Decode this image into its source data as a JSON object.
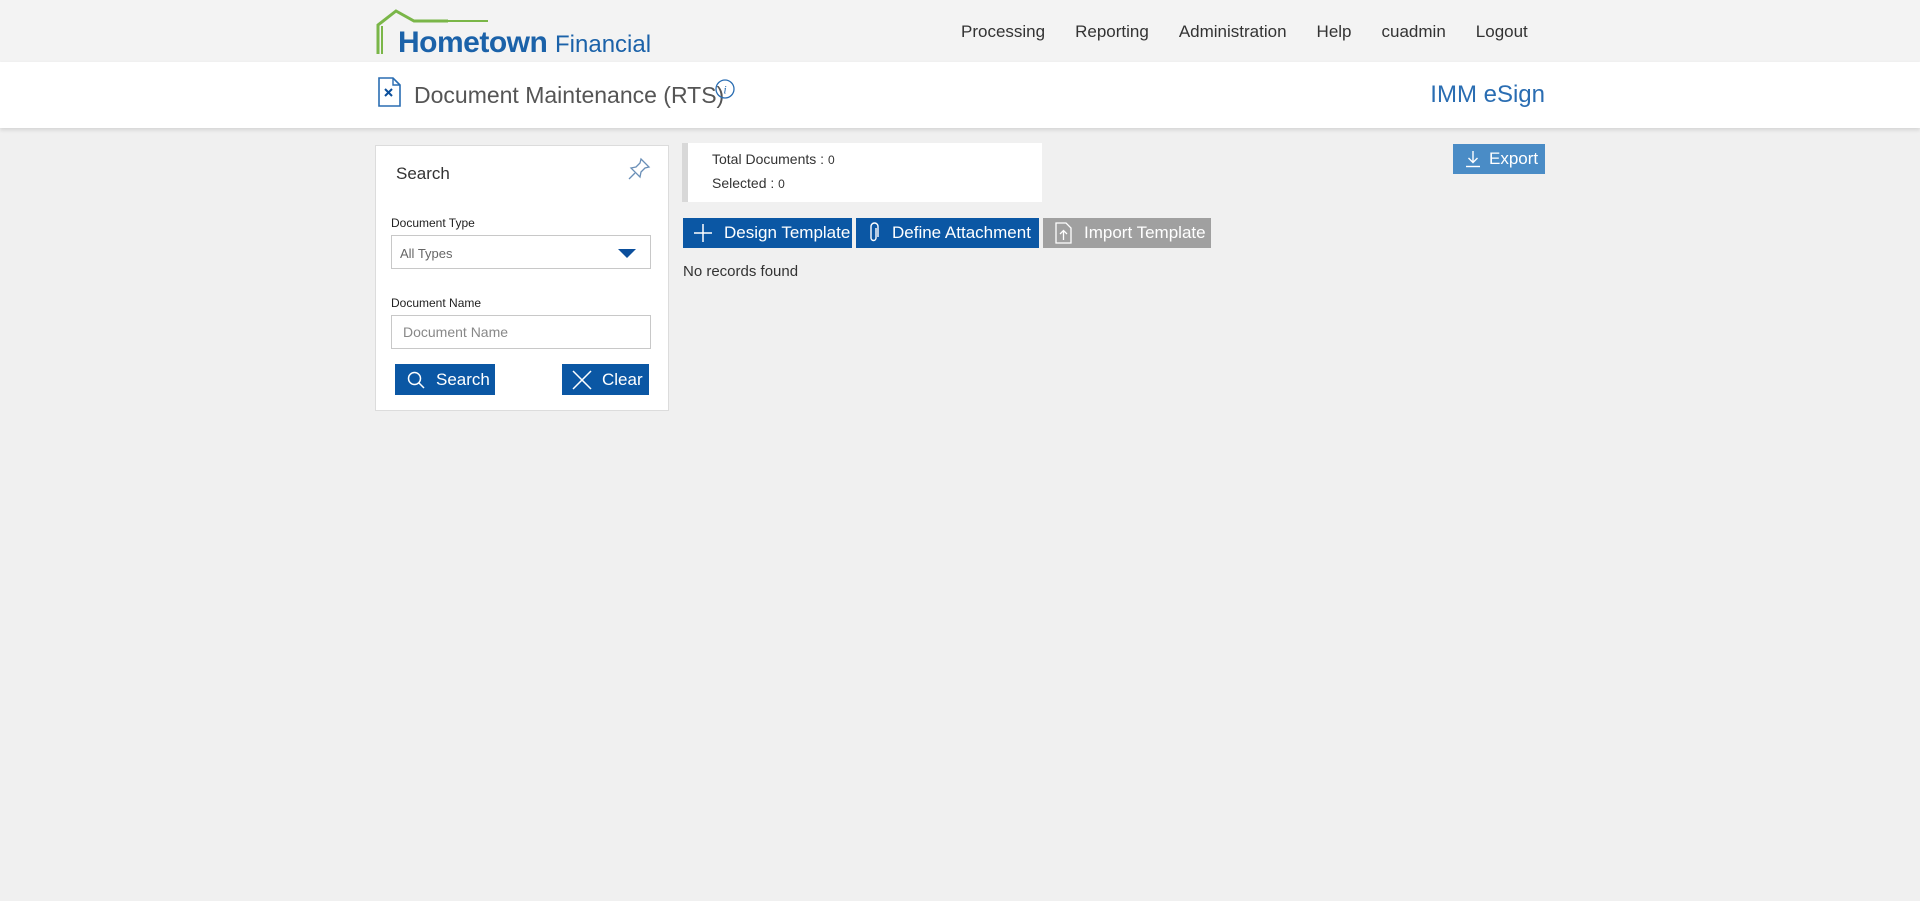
{
  "brand": {
    "name_primary": "Hometown",
    "name_secondary": "Financial",
    "logo_color": "#1b62a9",
    "roof_color": "#7ab648"
  },
  "nav": {
    "items": [
      "Processing",
      "Reporting",
      "Administration",
      "Help",
      "cuadmin",
      "Logout"
    ]
  },
  "header": {
    "page_title": "Document Maintenance (RTS)",
    "page_icon": "document-x-icon",
    "info_icon": "info-icon",
    "product_name": "IMM eSign"
  },
  "search_panel": {
    "title": "Search",
    "pin_icon": "pin-icon",
    "document_type": {
      "label": "Document Type",
      "selected": "All Types"
    },
    "document_name": {
      "label": "Document Name",
      "placeholder": "Document Name",
      "value": ""
    },
    "search_button": "Search",
    "clear_button": "Clear"
  },
  "summary": {
    "total_label": "Total Documents : ",
    "total_value": "0",
    "selected_label": "Selected : ",
    "selected_value": "0"
  },
  "actions": {
    "design_template": "Design Template",
    "define_attachment": "Define Attachment",
    "import_template": "Import Template",
    "export": "Export"
  },
  "results": {
    "empty_message": "No records found"
  },
  "colors": {
    "primary_button": "#0b57a4",
    "disabled_button": "#a0a0a0",
    "export_button": "#4a8cc6",
    "product_text": "#2a6db2"
  }
}
